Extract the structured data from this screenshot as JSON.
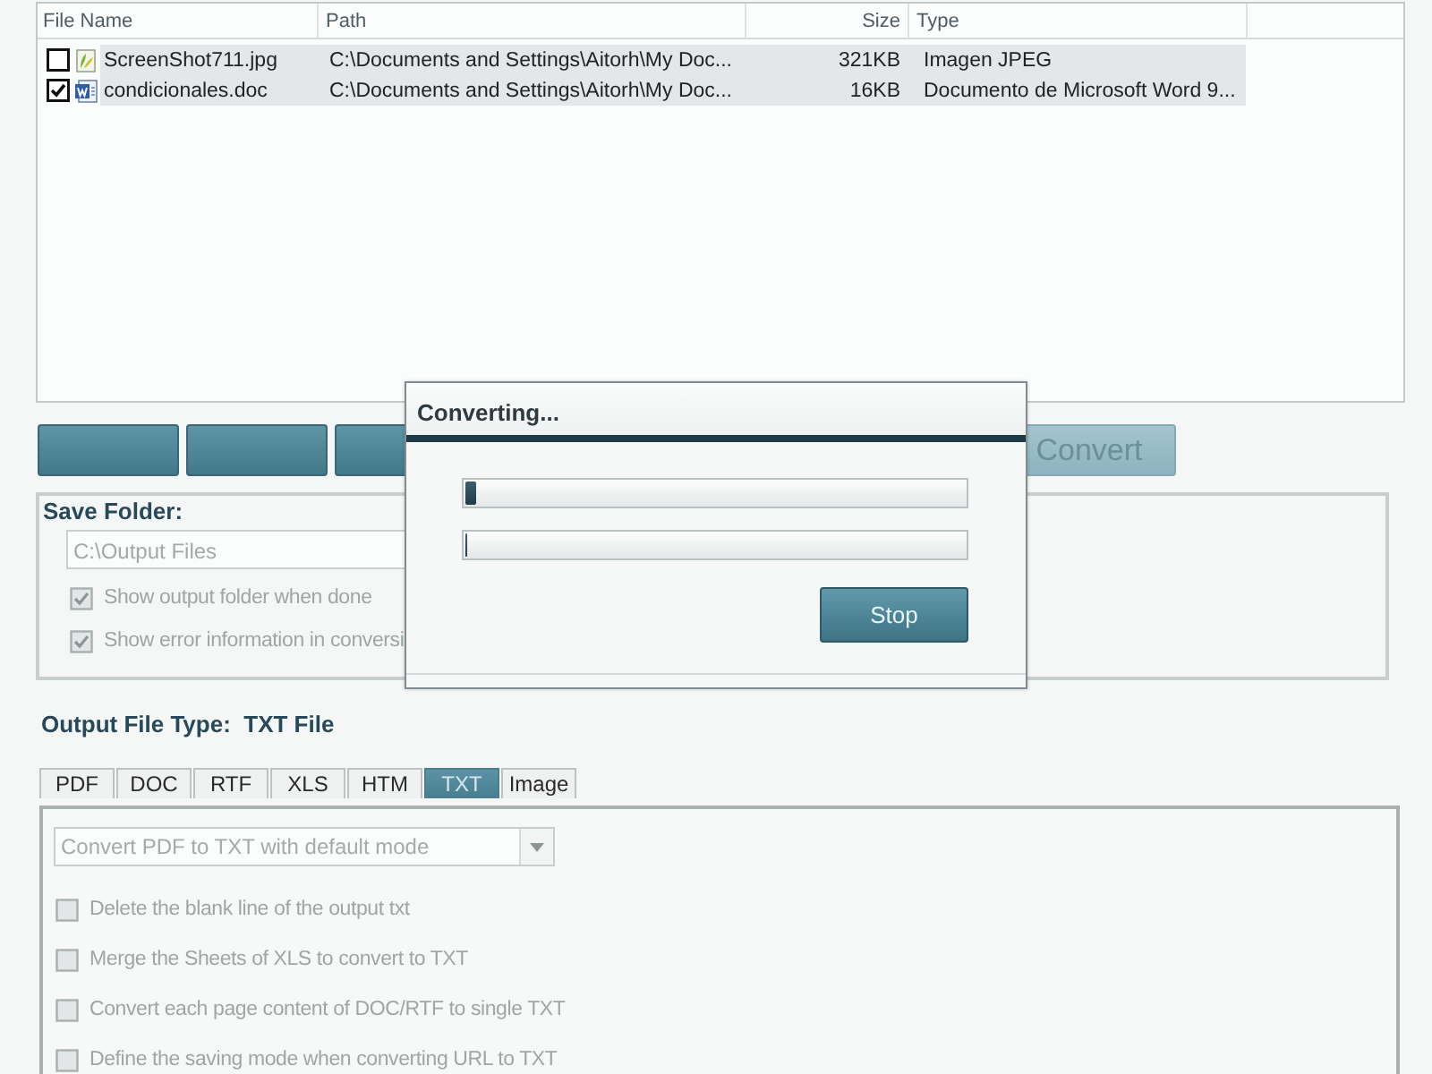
{
  "file_list": {
    "columns": [
      "File Name",
      "Path",
      "Size",
      "Type"
    ],
    "rows": [
      {
        "checked": false,
        "kind": "image",
        "name": "ScreenShot711.jpg",
        "path": "C:\\Documents and Settings\\Aitorh\\My Doc...",
        "size": "321KB",
        "type": "Imagen JPEG"
      },
      {
        "checked": true,
        "kind": "document",
        "name": "condicionales.doc",
        "path": "C:\\Documents and Settings\\Aitorh\\My Doc...",
        "size": "16KB",
        "type": "Documento de Microsoft Word 9..."
      }
    ]
  },
  "action_buttons": [
    {
      "kind": "blank"
    },
    {
      "kind": "blank"
    },
    {
      "kind": "blank"
    },
    {
      "kind": "labeled",
      "label": "Convert",
      "disabled": true
    }
  ],
  "save_folder": {
    "title": "Save Folder:",
    "path": "C:\\Output Files",
    "disabled": true,
    "options": [
      {
        "label": "Show output folder when done",
        "checked": true
      },
      {
        "label": "Show error information in conversi",
        "checked": true
      }
    ]
  },
  "output_type": {
    "label": "Output File Type:",
    "value": "TXT File"
  },
  "tabs": [
    {
      "label": "PDF",
      "selected": false
    },
    {
      "label": "DOC",
      "selected": false
    },
    {
      "label": "RTF",
      "selected": false
    },
    {
      "label": "XLS",
      "selected": false
    },
    {
      "label": "HTM",
      "selected": false
    },
    {
      "label": "TXT",
      "selected": true
    },
    {
      "label": "Image",
      "selected": false
    }
  ],
  "txt_options": {
    "disabled": true,
    "mode": "Convert PDF to TXT with default mode",
    "options": [
      {
        "label": "Delete the blank line of the output txt",
        "checked": false
      },
      {
        "label": "Merge the Sheets of XLS to convert to TXT",
        "checked": false
      },
      {
        "label": "Convert each page content of DOC/RTF to single TXT",
        "checked": false
      },
      {
        "label": "Define the saving mode when converting URL to TXT",
        "checked": false
      }
    ]
  },
  "dialog": {
    "title": "Converting...",
    "progress": [
      {
        "level": 0.02
      },
      {
        "level": 0
      }
    ],
    "stop_button": "Stop"
  }
}
